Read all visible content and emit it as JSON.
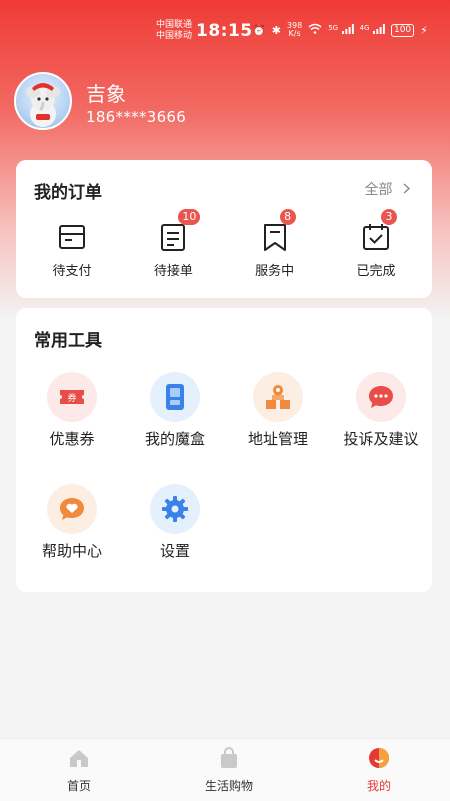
{
  "status_bar": {
    "carrier1": "中国联通",
    "carrier2": "中国移动",
    "time": "18:15",
    "net_speed": "398",
    "net_unit": "K/s",
    "network1": "5G",
    "network2": "4G",
    "battery": "100"
  },
  "profile": {
    "name": "吉象",
    "phone": "186****3666"
  },
  "orders": {
    "title": "我的订单",
    "all_label": "全部",
    "items": [
      {
        "label": "待支付",
        "badge": ""
      },
      {
        "label": "待接单",
        "badge": "10"
      },
      {
        "label": "服务中",
        "badge": "8"
      },
      {
        "label": "已完成",
        "badge": "3"
      }
    ]
  },
  "tools": {
    "title": "常用工具",
    "items": [
      {
        "label": "优惠券",
        "icon": "coupon-icon"
      },
      {
        "label": "我的魔盒",
        "icon": "magic-box-icon"
      },
      {
        "label": "地址管理",
        "icon": "address-icon"
      },
      {
        "label": "投诉及建议",
        "icon": "feedback-icon"
      },
      {
        "label": "帮助中心",
        "icon": "help-icon"
      },
      {
        "label": "设置",
        "icon": "settings-icon"
      }
    ]
  },
  "nav": {
    "items": [
      {
        "label": "首页",
        "icon": "home-icon"
      },
      {
        "label": "生活购物",
        "icon": "shopping-bag-icon"
      },
      {
        "label": "我的",
        "icon": "profile-icon",
        "active": true
      }
    ]
  },
  "colors": {
    "accent": "#ea5550",
    "header_red": "#ef3b36"
  }
}
